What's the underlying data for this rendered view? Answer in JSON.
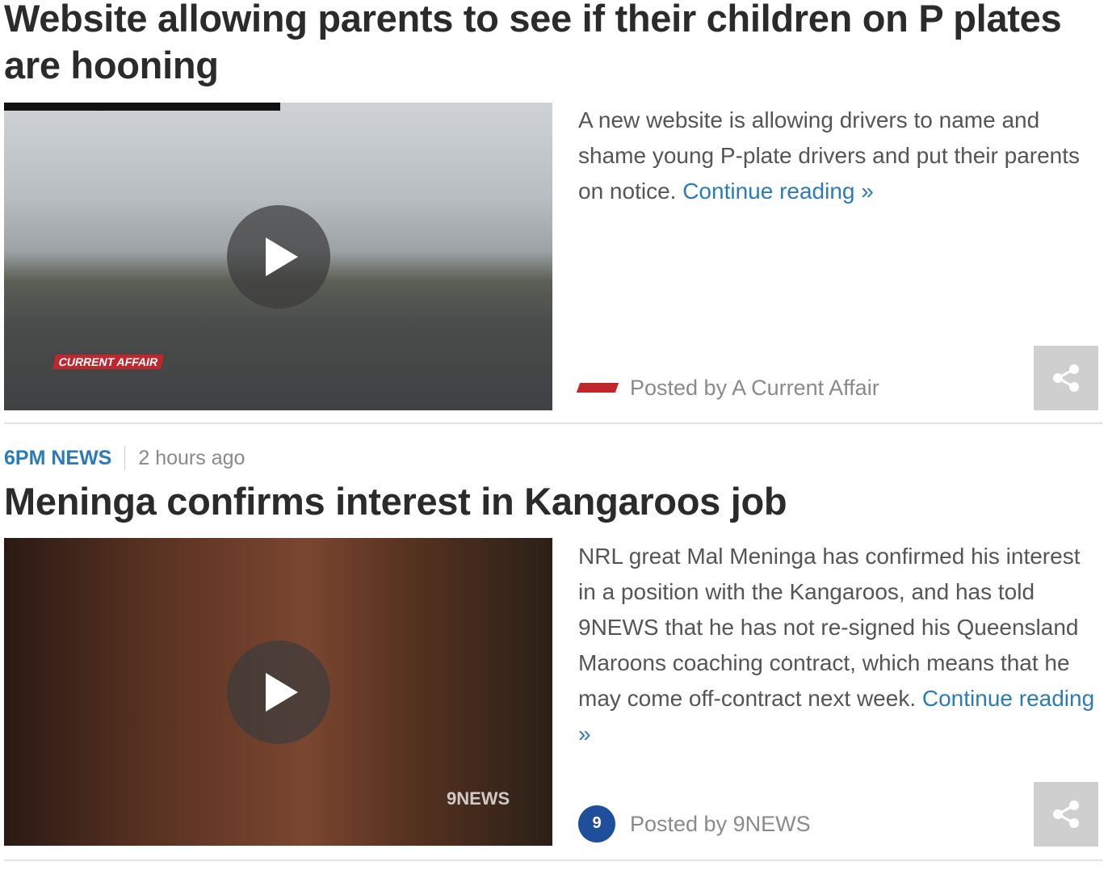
{
  "articles": [
    {
      "headline": "Website allowing parents to see if their children on P plates are hooning",
      "summary": "A new website is allowing drivers to name and shame young P-plate drivers and put their parents on notice.",
      "continue_label": "Continue reading »",
      "posted_by": "Posted by A Current Affair",
      "video_watermark": "CURRENT AFFAIR"
    },
    {
      "section": "6PM NEWS",
      "time": "2 hours ago",
      "headline": "Meninga confirms interest in Kangaroos job",
      "summary": "NRL great Mal Meninga has confirmed his interest in a position with the Kangaroos, and has told 9NEWS that he has not re-signed his Queensland Maroons coaching contract, which means that he may come off-contract next week.",
      "continue_label": "Continue reading »",
      "posted_by": "Posted by 9NEWS",
      "video_watermark": "9NEWS"
    }
  ],
  "colors": {
    "link": "#2b7bb9",
    "headline": "#2b2b2b",
    "muted": "#8a8a8a",
    "share_bg": "#cfcfcf"
  },
  "icons": [
    "play-icon",
    "share-icon",
    "a-current-affair-logo",
    "9news-logo"
  ]
}
